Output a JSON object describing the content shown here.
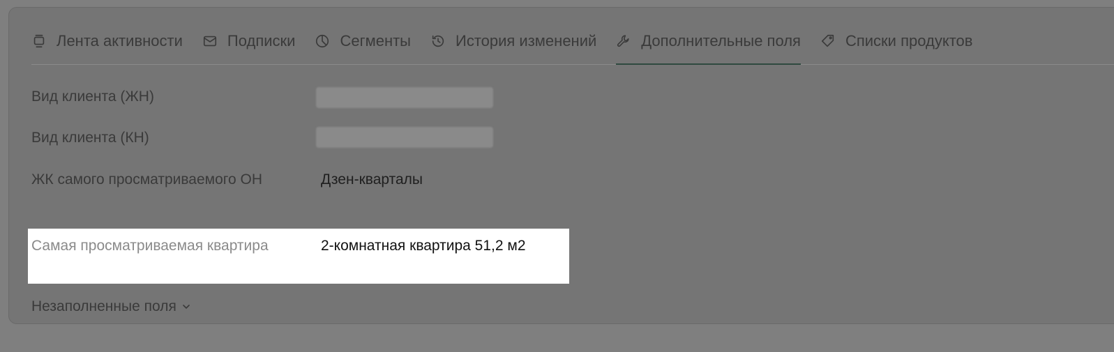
{
  "tabs": [
    {
      "label": "Лента активности",
      "icon": "activity-feed-icon"
    },
    {
      "label": "Подписки",
      "icon": "mail-icon"
    },
    {
      "label": "Сегменты",
      "icon": "pie-chart-icon"
    },
    {
      "label": "История изменений",
      "icon": "history-icon"
    },
    {
      "label": "Дополнительные поля",
      "icon": "wrench-icon",
      "active": true
    },
    {
      "label": "Списки продуктов",
      "icon": "tag-icon"
    }
  ],
  "fields": [
    {
      "label": "Вид клиента (ЖН)",
      "value": ""
    },
    {
      "label": "Вид клиента (КН)",
      "value": ""
    },
    {
      "label": "ЖК самого просматриваемого ОН",
      "value": "Дзен-кварталы"
    },
    {
      "label": "Самая просматриваемая квартира",
      "value": "2-комнатная квартира 51,2 м2"
    }
  ],
  "empty_fields_toggle": "Незаполненные поля"
}
